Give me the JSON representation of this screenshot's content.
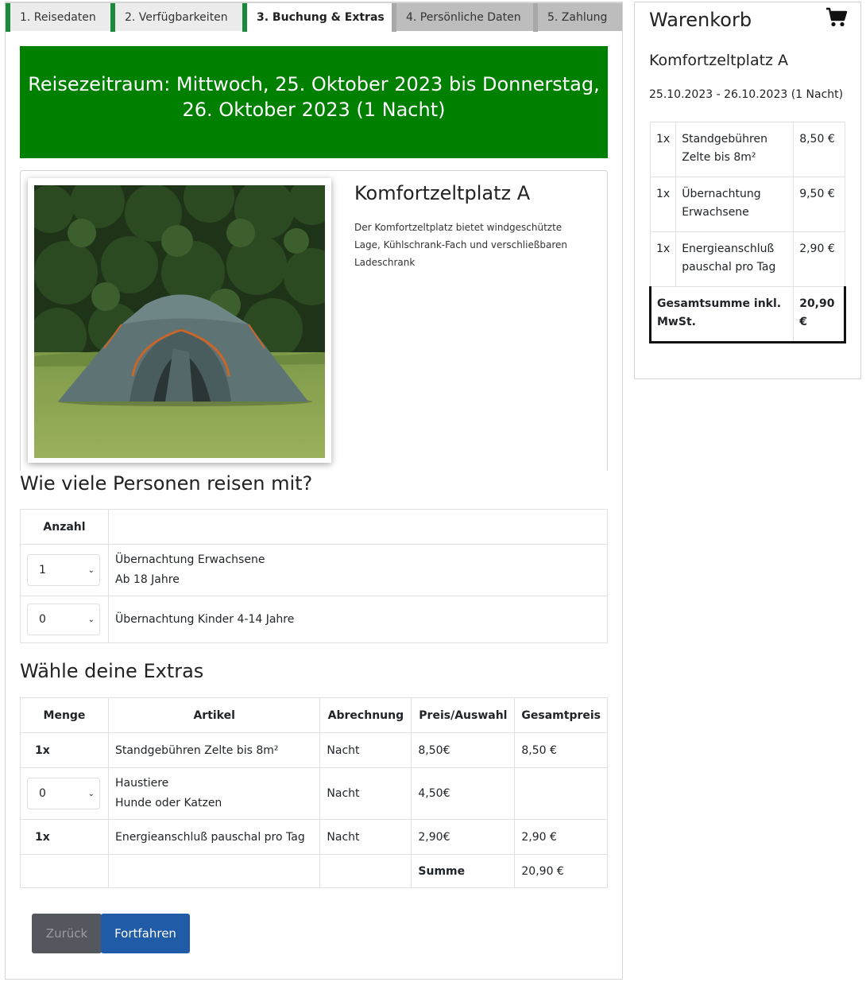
{
  "steps": [
    {
      "label": "1. Reisedaten",
      "state": "done"
    },
    {
      "label": "2. Verfügbarkeiten",
      "state": "done"
    },
    {
      "label": "3. Buchung & Extras",
      "state": "active"
    },
    {
      "label": "4. Persönliche Daten",
      "state": "todo"
    },
    {
      "label": "5. Zahlung",
      "state": "todo"
    }
  ],
  "banner": {
    "line1": "Reisezeitraum: Mittwoch, 25. Oktober 2023 bis Donnerstag,",
    "line2": "26. Oktober 2023 (1 Nacht)"
  },
  "product": {
    "title": "Komfortzeltplatz A",
    "description": "Der Komfortzeltplatz bietet windgeschützte Lage, Kühlschrank-Fach und verschließbaren Ladeschrank"
  },
  "persons": {
    "title": "Wie viele Personen reisen mit?",
    "header_count": "Anzahl",
    "rows": [
      {
        "value": "1",
        "label": "Übernachtung Erwachsene",
        "sub": "Ab 18 Jahre"
      },
      {
        "value": "0",
        "label": "Übernachtung Kinder 4-14 Jahre",
        "sub": ""
      }
    ]
  },
  "extras": {
    "title": "Wähle deine Extras",
    "headers": [
      "Menge",
      "Artikel",
      "Abrechnung",
      "Preis/Auswahl",
      "Gesamtpreis"
    ],
    "rows": [
      {
        "qty": "1x",
        "item": "Standgebühren Zelte bis 8m²",
        "sub": "",
        "billing": "Nacht",
        "price": "8,50€",
        "total": "8,50 €"
      },
      {
        "qty": "0",
        "item": "Haustiere",
        "sub": "Hunde oder Katzen",
        "billing": "Nacht",
        "price": "4,50€",
        "total": ""
      },
      {
        "qty": "1x",
        "item": "Energieanschluß pauschal pro Tag",
        "sub": "",
        "billing": "Nacht",
        "price": "2,90€",
        "total": "2,90 €"
      }
    ],
    "sum_label": "Summe",
    "sum_value": "20,90 €"
  },
  "buttons": {
    "back": "Zurück",
    "next": "Fortfahren"
  },
  "cart": {
    "title": "Warenkorb",
    "item_title": "Komfortzeltplatz A",
    "dates": "25.10.2023 - 26.10.2023 (1 Nacht)",
    "rows": [
      {
        "qty": "1x",
        "label": "Standgebühren Zelte bis 8m²",
        "price": "8,50 €"
      },
      {
        "qty": "1x",
        "label": "Übernachtung Erwachsene",
        "price": "9,50 €"
      },
      {
        "qty": "1x",
        "label": "Energieanschluß pauschal pro Tag",
        "price": "2,90 €"
      }
    ],
    "total_label": "Gesamtsumme inkl. MwSt.",
    "total_value": "20,90 €"
  },
  "colors": {
    "accent": "#008000",
    "step_bar": "#198a3a",
    "primary": "#1f5ba6"
  },
  "icons": {
    "cart": "shopping-cart-icon",
    "chevron": "chevron-down-icon"
  }
}
